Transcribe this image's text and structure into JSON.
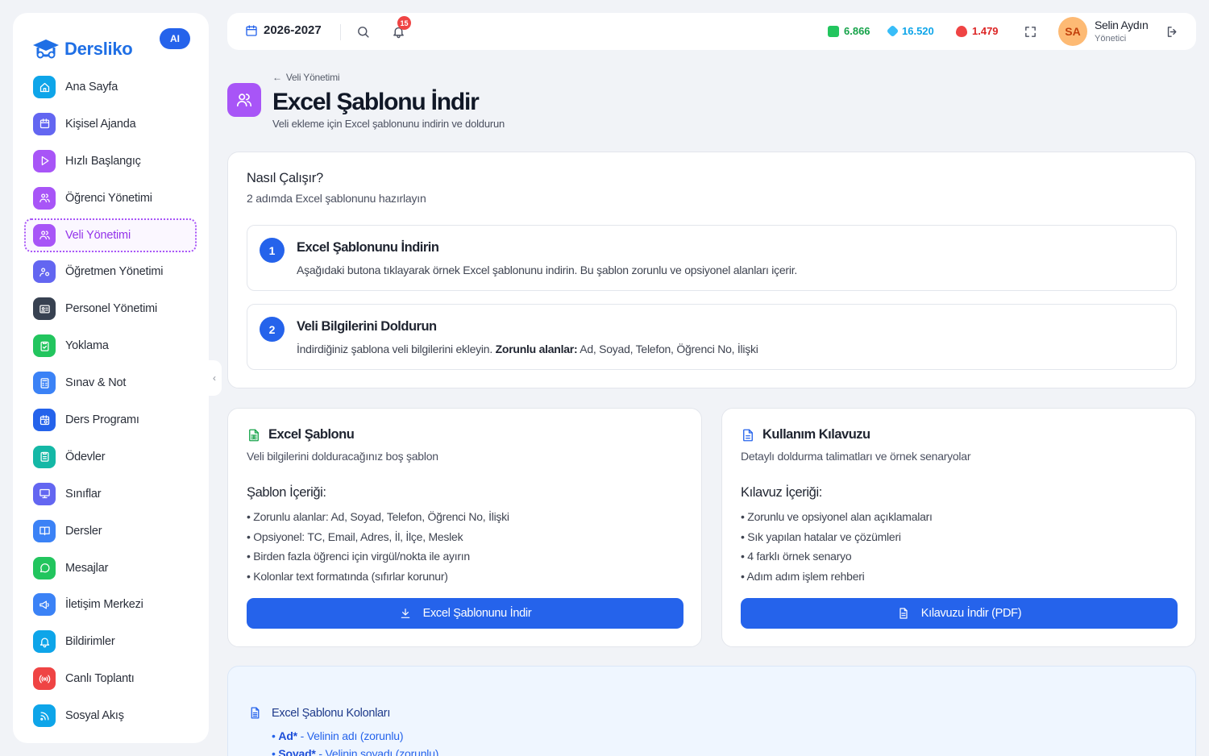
{
  "app": {
    "name": "Dersliko",
    "ai_badge": "AI"
  },
  "sidebar": {
    "items": [
      {
        "label": "Ana Sayfa",
        "icon": "home-icon",
        "color": "#0ea5e9"
      },
      {
        "label": "Kişisel Ajanda",
        "icon": "calendar-icon",
        "color": "#6366f1"
      },
      {
        "label": "Hızlı Başlangıç",
        "icon": "play-icon",
        "color": "#a855f7"
      },
      {
        "label": "Öğrenci Yönetimi",
        "icon": "users-icon",
        "color": "#a855f7"
      },
      {
        "label": "Veli Yönetimi",
        "icon": "users-icon",
        "color": "#a855f7",
        "active": true
      },
      {
        "label": "Öğretmen Yönetimi",
        "icon": "teacher-icon",
        "color": "#6366f1"
      },
      {
        "label": "Personel Yönetimi",
        "icon": "id-card-icon",
        "color": "#374151"
      },
      {
        "label": "Yoklama",
        "icon": "clipboard-check-icon",
        "color": "#22c55e"
      },
      {
        "label": "Sınav & Not",
        "icon": "calculator-icon",
        "color": "#3b82f6"
      },
      {
        "label": "Ders Programı",
        "icon": "calendar-clock-icon",
        "color": "#2563eb"
      },
      {
        "label": "Ödevler",
        "icon": "clipboard-icon",
        "color": "#14b8a6"
      },
      {
        "label": "Sınıflar",
        "icon": "presentation-icon",
        "color": "#6366f1"
      },
      {
        "label": "Dersler",
        "icon": "book-icon",
        "color": "#3b82f6"
      },
      {
        "label": "Mesajlar",
        "icon": "message-icon",
        "color": "#22c55e"
      },
      {
        "label": "İletişim Merkezi",
        "icon": "megaphone-icon",
        "color": "#3b82f6"
      },
      {
        "label": "Bildirimler",
        "icon": "bell-icon",
        "color": "#0ea5e9"
      },
      {
        "label": "Canlı Toplantı",
        "icon": "broadcast-icon",
        "color": "#ef4444"
      },
      {
        "label": "Sosyal Akış",
        "icon": "rss-icon",
        "color": "#0ea5e9"
      }
    ]
  },
  "topbar": {
    "year": "2026-2027",
    "notification_count": "15",
    "stats": [
      {
        "value": "6.866",
        "color": "#16a34a",
        "icon": "money-icon"
      },
      {
        "value": "16.520",
        "color": "#0ea5e9",
        "icon": "diamond-icon"
      },
      {
        "value": "1.479",
        "color": "#dc2626",
        "icon": "flame-icon"
      }
    ],
    "user": {
      "initials": "SA",
      "name": "Selin Aydın",
      "role": "Yönetici"
    }
  },
  "header": {
    "back_label": "Veli Yönetimi",
    "title": "Excel Şablonu İndir",
    "subtitle": "Veli ekleme için Excel şablonunu indirin ve doldurun"
  },
  "howto": {
    "title": "Nasıl Çalışır?",
    "subtitle": "2 adımda Excel şablonunu hazırlayın",
    "steps": [
      {
        "num": "1",
        "title": "Excel Şablonunu İndirin",
        "desc": "Aşağıdaki butona tıklayarak örnek Excel şablonunu indirin. Bu şablon zorunlu ve opsiyonel alanları içerir."
      },
      {
        "num": "2",
        "title": "Veli Bilgilerini Doldurun",
        "desc_prefix": "İndirdiğiniz şablona veli bilgilerini ekleyin.",
        "desc_bold": "Zorunlu alanlar:",
        "desc_suffix": "Ad, Soyad, Telefon, Öğrenci No, İlişki"
      }
    ]
  },
  "template_card": {
    "title": "Excel Şablonu",
    "subtitle": "Veli bilgilerini dolduracağınız boş şablon",
    "section": "Şablon İçeriği:",
    "items": [
      "Zorunlu alanlar: Ad, Soyad, Telefon, Öğrenci No, İlişki",
      "Opsiyonel: TC, Email, Adres, İl, İlçe, Meslek",
      "Birden fazla öğrenci için virgül/nokta ile ayırın",
      "Kolonlar text formatında (sıfırlar korunur)"
    ],
    "button": "Excel Şablonunu İndir"
  },
  "guide_card": {
    "title": "Kullanım Kılavuzu",
    "subtitle": "Detaylı doldurma talimatları ve örnek senaryolar",
    "section": "Kılavuz İçeriği:",
    "items": [
      "Zorunlu ve opsiyonel alan açıklamaları",
      "Sık yapılan hatalar ve çözümleri",
      "4 farklı örnek senaryo",
      "Adım adım işlem rehberi"
    ],
    "button": "Kılavuzu İndir (PDF)"
  },
  "columns": {
    "title": "Excel Şablonu Kolonları",
    "items": [
      {
        "name": "Ad*",
        "desc": " - Velinin adı (zorunlu)"
      },
      {
        "name": "Soyad*",
        "desc": " - Velinin soyadı (zorunlu)"
      }
    ]
  }
}
